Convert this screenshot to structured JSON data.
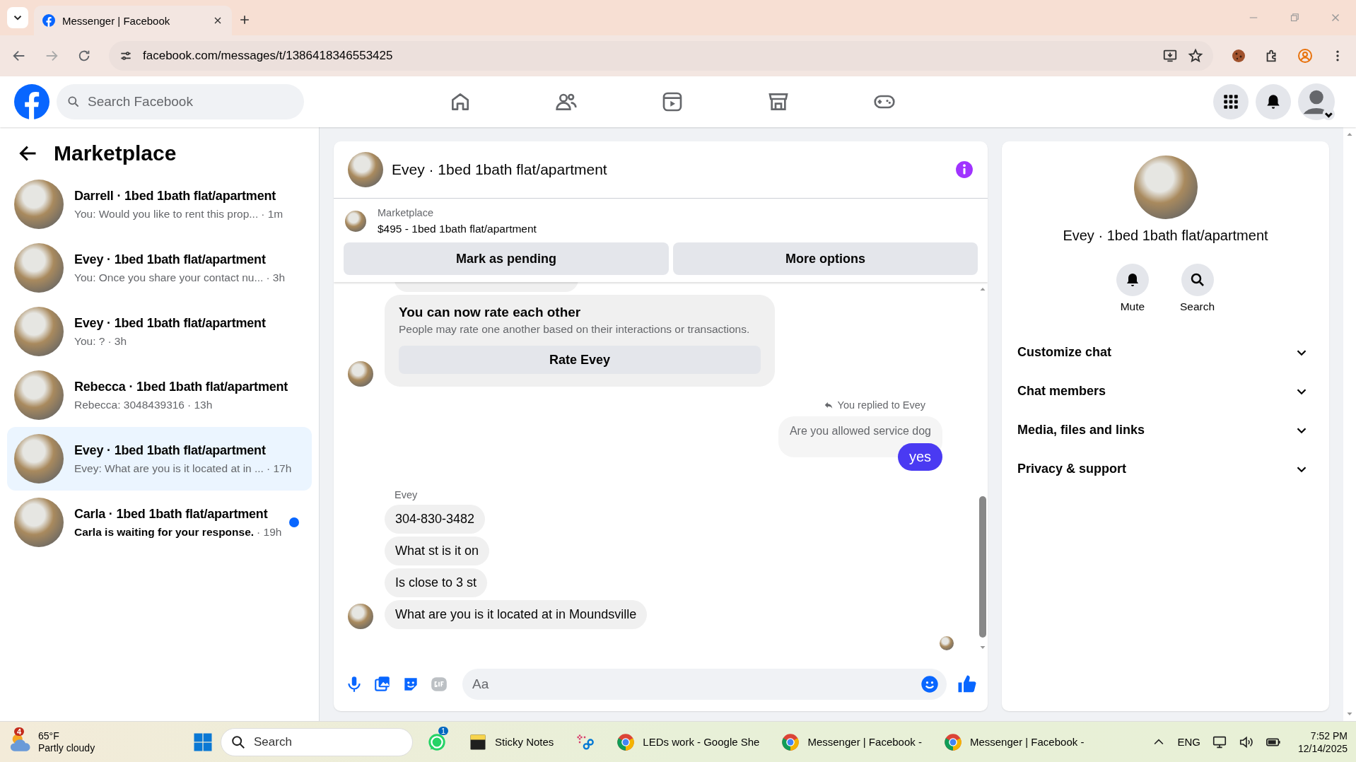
{
  "browser": {
    "tabs": [
      {
        "title": "Messenger | Facebook",
        "selected": true
      }
    ],
    "url": "facebook.com/messages/t/1386418346553425"
  },
  "facebook_nav": {
    "search_placeholder": "Search Facebook",
    "nav_items": [
      {
        "kind": "home"
      },
      {
        "kind": "friends"
      },
      {
        "kind": "video"
      },
      {
        "kind": "marketplace"
      },
      {
        "kind": "gaming"
      }
    ]
  },
  "sidebar": {
    "title": "Marketplace",
    "conversations": [
      {
        "title": "Darrell · 1bed 1bath flat/apartment",
        "preview": "You: Would you like to rent this prop...",
        "time": "· 1m",
        "selected": false,
        "unread": false
      },
      {
        "title": "Evey · 1bed 1bath flat/apartment",
        "preview": "You: Once you share your contact nu...",
        "time": "· 3h",
        "selected": false,
        "unread": false
      },
      {
        "title": "Evey · 1bed 1bath flat/apartment",
        "preview": "You: ?",
        "time": "· 3h",
        "selected": false,
        "unread": false
      },
      {
        "title": "Rebecca · 1bed 1bath flat/apartment",
        "preview": "Rebecca: 3048439316",
        "time": "· 13h",
        "selected": false,
        "unread": false
      },
      {
        "title": "Evey · 1bed 1bath flat/apartment",
        "preview": "Evey: What are you is it located at in ...",
        "time": "· 17h",
        "selected": true,
        "unread": false
      },
      {
        "title": "Carla · 1bed 1bath flat/apartment",
        "preview": "Carla is waiting for your response.",
        "time": "· 19h",
        "selected": false,
        "unread": true
      }
    ]
  },
  "chat": {
    "title": "Evey · 1bed 1bath flat/apartment",
    "listing": {
      "label": "Marketplace",
      "name": "$495 - 1bed 1bath flat/apartment"
    },
    "actions": [
      "Mark as pending",
      "More options"
    ],
    "messages": [
      {
        "kind": "rating_card",
        "title": "You can now rate each other",
        "text": "People may rate one another based on their interactions or transactions.",
        "button": "Rate Evey"
      },
      {
        "kind": "reply",
        "reply_label": "You replied to Evey",
        "quoted": "Are you allowed service dog",
        "text": "yes"
      },
      {
        "kind": "sender",
        "text": "Evey"
      },
      {
        "kind": "incoming",
        "text": "304-830-3482",
        "avatar": false
      },
      {
        "kind": "incoming",
        "text": "What st is it on",
        "avatar": false
      },
      {
        "kind": "incoming",
        "text": "Is close to 3 st",
        "avatar": false
      },
      {
        "kind": "incoming",
        "text": "What are you is it located at in Moundsville",
        "avatar": true
      }
    ],
    "composer": {
      "placeholder": "Aa"
    }
  },
  "details": {
    "title": "Evey · 1bed 1bath flat/apartment",
    "actions": [
      {
        "kind": "mute",
        "label": "Mute"
      },
      {
        "kind": "search",
        "label": "Search"
      }
    ],
    "sections": [
      {
        "label": "Customize chat",
        "expanded": false
      },
      {
        "label": "Chat members",
        "expanded": false
      },
      {
        "label": "Media, files and links",
        "expanded": false
      },
      {
        "label": "Privacy & support",
        "expanded": false
      }
    ]
  },
  "taskbar": {
    "weather": {
      "temperature": "65°F",
      "condition": "Partly cloudy",
      "badge": "4"
    },
    "search_placeholder": "Search",
    "apps": [
      {
        "kind": "whatsapp",
        "badge": "1"
      },
      {
        "kind": "sticky",
        "label": "Sticky Notes"
      },
      {
        "kind": "snip"
      },
      {
        "kind": "chrome",
        "label": "LEDs work - Google She"
      },
      {
        "kind": "chrome",
        "label": "Messenger | Facebook -"
      },
      {
        "kind": "chrome",
        "label": "Messenger | Facebook -"
      }
    ],
    "language": "ENG",
    "time": "7:52 PM",
    "date": "12/14/2025"
  }
}
